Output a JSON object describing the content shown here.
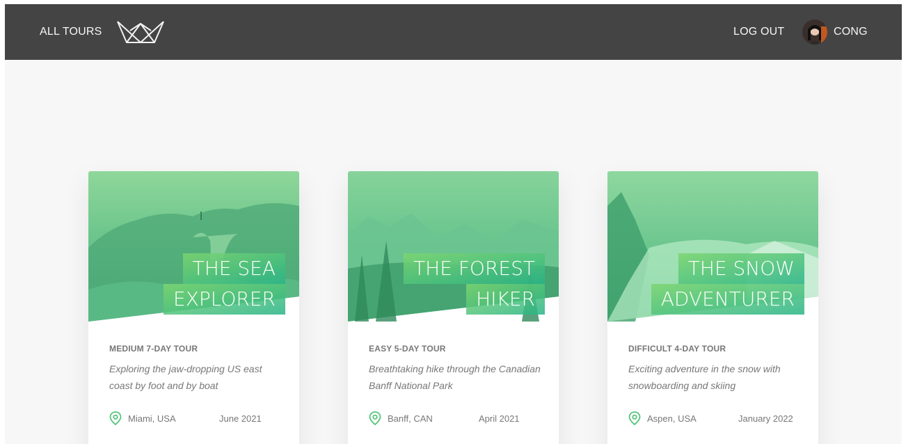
{
  "header": {
    "all_tours_label": "ALL TOURS",
    "logout_label": "LOG OUT",
    "user_name": "CONG"
  },
  "tours": [
    {
      "title_line1": "THE SEA",
      "title_line2": "EXPLORER",
      "subtitle": "MEDIUM 7-DAY TOUR",
      "description": "Exploring the jaw-dropping US east coast by foot and by boat",
      "location": "Miami, USA",
      "date": "June 2021"
    },
    {
      "title_line1": "THE FOREST",
      "title_line2": "HIKER",
      "subtitle": "EASY 5-DAY TOUR",
      "description": "Breathtaking hike through the Canadian Banff National Park",
      "location": "Banff, CAN",
      "date": "April 2021"
    },
    {
      "title_line1": "THE SNOW",
      "title_line2": "ADVENTURER",
      "subtitle": "DIFFICULT 4-DAY TOUR",
      "description": "Exciting adventure in the snow with snowboarding and skiing",
      "location": "Aspen, USA",
      "date": "January 2022"
    }
  ],
  "colors": {
    "header_bg": "#444444",
    "page_bg": "#f7f7f7",
    "accent_green": "#55c57a",
    "text_gray": "#777777"
  },
  "icons": {
    "logo": "crown-logo-icon",
    "location": "map-pin-icon"
  }
}
